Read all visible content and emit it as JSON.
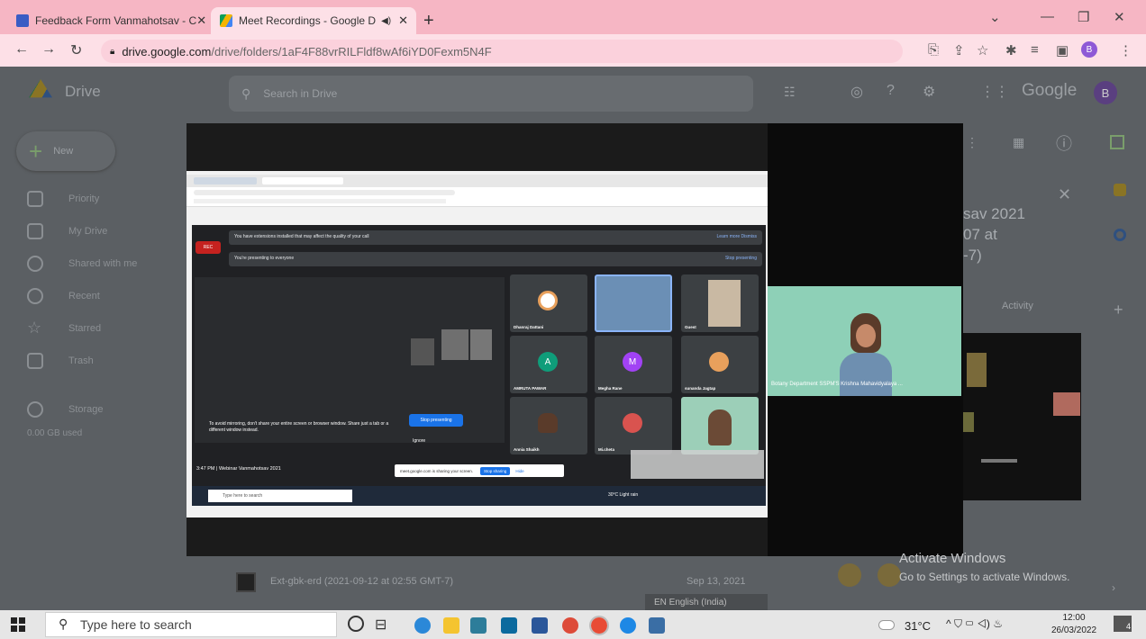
{
  "browser": {
    "tabs": [
      {
        "label": "Feedback Form Vanmahotsav - C",
        "icon_color": "#3a5cc4"
      },
      {
        "label": "Meet Recordings - Google D",
        "icon_color": "#f4b400"
      }
    ],
    "url_host": "drive.google.com",
    "url_path": "/drive/folders/1aF4F88vrRILFldf8wAf6iYD0Fexm5N4F"
  },
  "drive": {
    "logo": "Drive",
    "search_placeholder": "Search in Drive",
    "brand": "Google",
    "new_label": "New",
    "avatar_letter": "B",
    "side": [
      "Priority",
      "My Drive",
      "Shared with me",
      "Recent",
      "Starred",
      "Trash",
      "Storage"
    ],
    "storage": "0.00 GB used",
    "details_title": [
      "sav 2021",
      "07 at",
      "-7)"
    ],
    "details_tab": "Activity",
    "file_row": "Ext-gbk-erd (2021-09-12 at 02:55 GMT-7)",
    "file_date": "Sep 13, 2021"
  },
  "shared_screen": {
    "banner1": "You have extensions installed that may affect the quality of your call",
    "banner1_links": "Learn more   Dismiss",
    "banner2": "You're presenting to everyone",
    "banner2_link": "Stop presenting",
    "rec": "REC",
    "participants": [
      {
        "name": "Dhanraj Dattani",
        "initial": "",
        "color": "#fff"
      },
      {
        "name": "",
        "initial": "",
        "color": "#6b8fb5"
      },
      {
        "name": "Guest",
        "initial": "",
        "color": "#c9b9a3"
      },
      {
        "name": "AMRUTA PAWAR",
        "initial": "A",
        "color": "#0f9d7a"
      },
      {
        "name": "Megha Rane",
        "initial": "M",
        "color": "#a142f4"
      },
      {
        "name": "sunanda Jagtap",
        "initial": "",
        "color": "#e8a05c"
      },
      {
        "name": "Annia Shaikh",
        "initial": "",
        "color": "#5a3b2a"
      },
      {
        "name": "Mi.cheta",
        "initial": "",
        "color": "#d9534f"
      },
      {
        "name": "",
        "initial": "",
        "color": "#9ccfb8"
      }
    ],
    "warning": "To avoid mirroring, don't share your entire screen or browser window. Share just a tab or a different window instead.",
    "stop_presenting": "Stop presenting",
    "ignore": "Ignore",
    "meeting_info": "3:47 PM  |  Webinar Vanmahotsav 2021",
    "sharing_notice": "meet.google.com is sharing your screen.",
    "stop_sharing": "Stop sharing",
    "hide": "Hide",
    "taskbar_search": "Type here to search",
    "weather": "30°C Light rain"
  },
  "presenter": {
    "label": "Botany Department SSPM'S Krishna Mahavidyalaya ..."
  },
  "activate": {
    "title": "Activate Windows",
    "subtitle": "Go to Settings to activate Windows."
  },
  "language_tooltip": "EN English (India)",
  "taskbar": {
    "search_placeholder": "Type here to search",
    "temperature": "31°C",
    "time": "12:00",
    "date": "26/03/2022",
    "notifications": "4"
  }
}
